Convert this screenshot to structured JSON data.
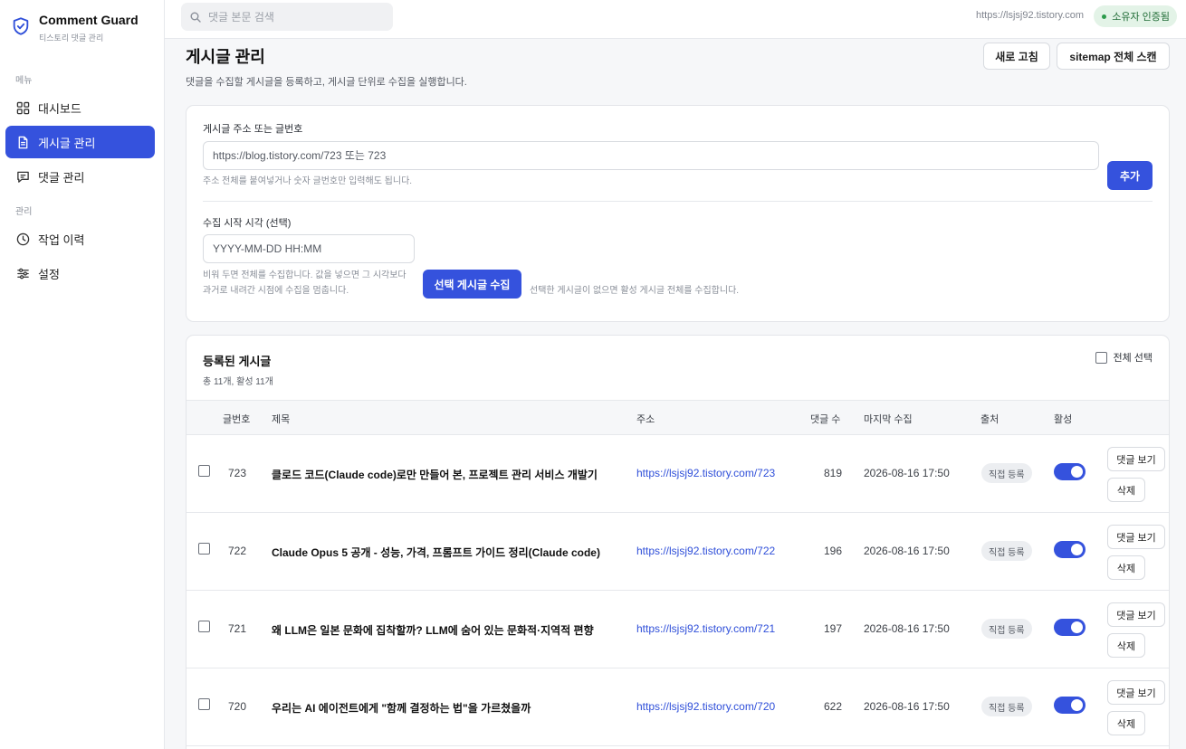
{
  "app": {
    "title": "Comment Guard",
    "subtitle": "티스토리 댓글 관리"
  },
  "sidebar": {
    "section_menu": "메뉴",
    "section_manage": "관리",
    "items": [
      {
        "label": "대시보드",
        "icon": "grid-icon"
      },
      {
        "label": "게시글 관리",
        "icon": "document-icon",
        "active": true
      },
      {
        "label": "댓글 관리",
        "icon": "chat-icon"
      },
      {
        "label": "작업 이력",
        "icon": "clock-icon"
      },
      {
        "label": "설정",
        "icon": "sliders-icon"
      }
    ]
  },
  "topbar": {
    "search_placeholder": "댓글 본문 검색",
    "blog_url": "https://lsjsj92.tistory.com",
    "owner_badge": "소유자 인증됨"
  },
  "page": {
    "title": "게시글 관리",
    "description": "댓글을 수집할 게시글을 등록하고, 게시글 단위로 수집을 실행합니다.",
    "refresh_label": "새로 고침",
    "sitemap_label": "sitemap 전체 스캔"
  },
  "form": {
    "url_label": "게시글 주소 또는 글번호",
    "url_placeholder": "https://blog.tistory.com/723 또는 723",
    "url_hint": "주소 전체를 붙여넣거나 숫자 글번호만 입력해도 됩니다.",
    "add_label": "추가",
    "start_label": "수집 시작 시각 (선택)",
    "start_placeholder": "YYYY-MM-DD HH:MM",
    "start_hint_1": "비워 두면 전체를 수집합니다. 값을 넣으면 그 시각보다",
    "start_hint_2": "과거로 내려간 시점에 수집을 멈춥니다.",
    "collect_label": "선택 게시글 수집",
    "collect_hint": "선택한 게시글이 없으면 활성 게시글 전체를 수집합니다."
  },
  "list": {
    "title": "등록된 게시글",
    "count": "총 11개, 활성 11개",
    "select_all": "전체 선택",
    "columns": [
      "글번호",
      "제목",
      "주소",
      "댓글 수",
      "마지막 수집",
      "출처",
      "활성"
    ],
    "view_label": "댓글 보기",
    "delete_label": "삭제",
    "rows": [
      {
        "num": "723",
        "title": "클로드 코드(Claude code)로만 만들어 본, 프로젝트 관리 서비스 개발기",
        "url": "https://lsjsj92.tistory.com/723",
        "comments": "819",
        "last": "2026-08-16 17:50",
        "source": "직접 등록",
        "active": true
      },
      {
        "num": "722",
        "title": "Claude Opus 5 공개 - 성능, 가격, 프롬프트 가이드 정리(Claude code)",
        "url": "https://lsjsj92.tistory.com/722",
        "comments": "196",
        "last": "2026-08-16 17:50",
        "source": "직접 등록",
        "active": true
      },
      {
        "num": "721",
        "title": "왜 LLM은 일본 문화에 집착할까? LLM에 숨어 있는 문화적·지역적 편향",
        "url": "https://lsjsj92.tistory.com/721",
        "comments": "197",
        "last": "2026-08-16 17:50",
        "source": "직접 등록",
        "active": true
      },
      {
        "num": "720",
        "title": "우리는 AI 에이전트에게 \"함께 결정하는 법\"을 가르쳤을까",
        "url": "https://lsjsj92.tistory.com/720",
        "comments": "622",
        "last": "2026-08-16 17:50",
        "source": "직접 등록",
        "active": true
      }
    ]
  },
  "colors": {
    "accent": "#3552dd",
    "badge_bg": "#e3f3e7",
    "badge_text": "#1f6b35"
  }
}
